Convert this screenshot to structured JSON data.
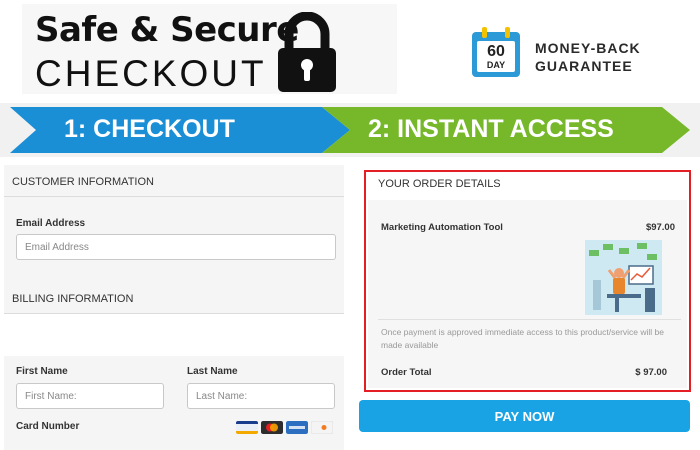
{
  "header": {
    "title_line1": "Safe & Secure",
    "title_line2": "CHECKOUT",
    "lock_icon": "padlock-icon",
    "calendar": {
      "icon": "calendar-icon",
      "number": "60",
      "unit": "DAY"
    },
    "guarantee_line1": "MONEY-BACK",
    "guarantee_line2": "GUARANTEE"
  },
  "steps": [
    {
      "label": "1: CHECKOUT",
      "color": "#1a8fd6"
    },
    {
      "label": "2: INSTANT ACCESS",
      "color": "#76b82a"
    }
  ],
  "customer": {
    "section_title": "CUSTOMER INFORMATION",
    "email_label": "Email Address",
    "email_placeholder": "Email Address"
  },
  "billing": {
    "section_title": "BILLING INFORMATION",
    "first_name_label": "First Name",
    "first_name_placeholder": "First Name:",
    "last_name_label": "Last Name",
    "last_name_placeholder": "Last Name:",
    "card_number_label": "Card Number",
    "card_icons": [
      "visa-icon",
      "mastercard-icon",
      "amex-icon",
      "discover-icon"
    ]
  },
  "order": {
    "section_title": "YOUR ORDER DETAILS",
    "item_name": "Marketing Automation Tool",
    "item_price": "$97.00",
    "notice": "Once payment is approved immediate access to this product/service will be made available",
    "total_label": "Order Total",
    "total_price": "$ 97.00",
    "highlight_color": "#e31e24"
  },
  "pay_button": {
    "label": "PAY NOW",
    "color": "#1aa3e4"
  }
}
